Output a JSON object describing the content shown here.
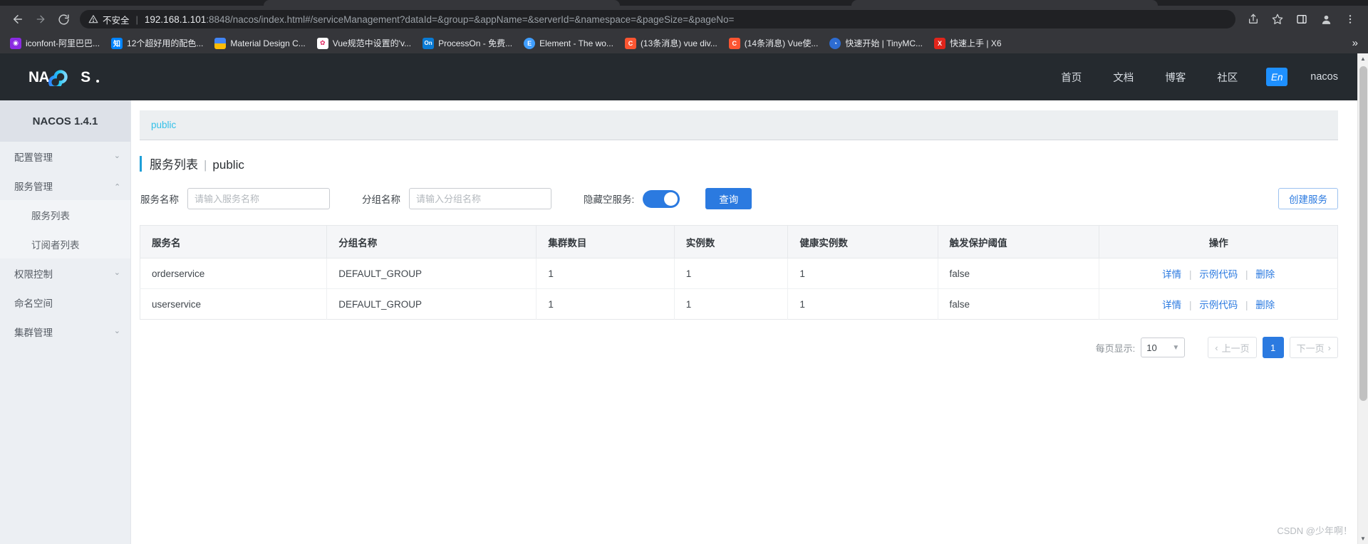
{
  "browser": {
    "back_icon": "back-arrow-icon",
    "forward_icon": "forward-arrow-icon",
    "reload_icon": "reload-icon",
    "insecure_label": "不安全",
    "url_host": "192.168.1.101",
    "url_rest": ":8848/nacos/index.html#/serviceManagement?dataId=&group=&appName=&serverId=&namespace=&pageSize=&pageNo=",
    "url_full": "192.168.1.101:8848/nacos/index.html#/serviceManagement?dataId=&group=&appName=&serverId=&namespace=&pageSize=&pageNo=",
    "overflow_label": "»",
    "bookmarks": [
      {
        "label": "iconfont-阿里巴巴...",
        "fav_text": "◉",
        "fav_bg": "#8a2be2"
      },
      {
        "label": "12个超好用的配色...",
        "fav_text": "知",
        "fav_bg": "#0084ff"
      },
      {
        "label": "Material Design C...",
        "fav_text": "",
        "fav_bg": "#4285f4"
      },
      {
        "label": "Vue规范中设置的'v...",
        "fav_text": "✿",
        "fav_bg": "#ffffff"
      },
      {
        "label": "ProcessOn - 免费...",
        "fav_text": "On",
        "fav_bg": "#0a7bd5"
      },
      {
        "label": "Element - The wo...",
        "fav_text": "E",
        "fav_bg": "#409eff"
      },
      {
        "label": "(13条消息) vue div...",
        "fav_text": "C",
        "fav_bg": "#fc5531"
      },
      {
        "label": "(14条消息) Vue使...",
        "fav_text": "C",
        "fav_bg": "#fc5531"
      },
      {
        "label": "快速开始 | TinyMC...",
        "fav_text": "◔",
        "fav_bg": "#2d6cd2"
      },
      {
        "label": "快速上手 | X6",
        "fav_text": "X",
        "fav_bg": "#e1251b"
      }
    ]
  },
  "header": {
    "logo_text": "NACOS.",
    "nav": [
      {
        "label": "首页"
      },
      {
        "label": "文档"
      },
      {
        "label": "博客"
      },
      {
        "label": "社区"
      }
    ],
    "lang_label": "En",
    "user_label": "nacos"
  },
  "sidebar": {
    "version": "NACOS 1.4.1",
    "items": [
      {
        "label": "配置管理",
        "sub": false,
        "chevron": "down",
        "active": false
      },
      {
        "label": "服务管理",
        "sub": false,
        "chevron": "up",
        "active": false
      },
      {
        "label": "服务列表",
        "sub": true,
        "chevron": "",
        "active": true
      },
      {
        "label": "订阅者列表",
        "sub": true,
        "chevron": "",
        "active": false
      },
      {
        "label": "权限控制",
        "sub": false,
        "chevron": "down",
        "active": false
      },
      {
        "label": "命名空间",
        "sub": false,
        "chevron": "",
        "active": false
      },
      {
        "label": "集群管理",
        "sub": false,
        "chevron": "down",
        "active": false
      }
    ]
  },
  "main": {
    "breadcrumb": "public",
    "title": "服务列表",
    "title_sep": "|",
    "title_namespace": "public",
    "search": {
      "service_name_label": "服务名称",
      "service_name_placeholder": "请输入服务名称",
      "service_name_value": "",
      "group_name_label": "分组名称",
      "group_name_placeholder": "请输入分组名称",
      "group_name_value": "",
      "hide_empty_label": "隐藏空服务:",
      "hide_empty_on": true,
      "query_button": "查询",
      "create_button": "创建服务"
    },
    "table": {
      "columns": [
        "服务名",
        "分组名称",
        "集群数目",
        "实例数",
        "健康实例数",
        "触发保护阈值",
        "操作"
      ],
      "rows": [
        {
          "service_name": "orderservice",
          "group_name": "DEFAULT_GROUP",
          "cluster_count": "1",
          "instance_count": "1",
          "healthy_count": "1",
          "threshold": "false",
          "actions": [
            "详情",
            "示例代码",
            "删除"
          ]
        },
        {
          "service_name": "userservice",
          "group_name": "DEFAULT_GROUP",
          "cluster_count": "1",
          "instance_count": "1",
          "healthy_count": "1",
          "threshold": "false",
          "actions": [
            "详情",
            "示例代码",
            "删除"
          ]
        }
      ],
      "action_separator": "|"
    },
    "pagination": {
      "page_size_label": "每页显示:",
      "page_size_value": "10",
      "prev_label": "上一页",
      "next_label": "下一页",
      "current_page": "1"
    }
  },
  "watermark": "CSDN @少年啊！",
  "colors": {
    "accent_blue": "#2b7ae0",
    "link_cyan": "#33c0e8",
    "header_dark": "#252a2f"
  }
}
